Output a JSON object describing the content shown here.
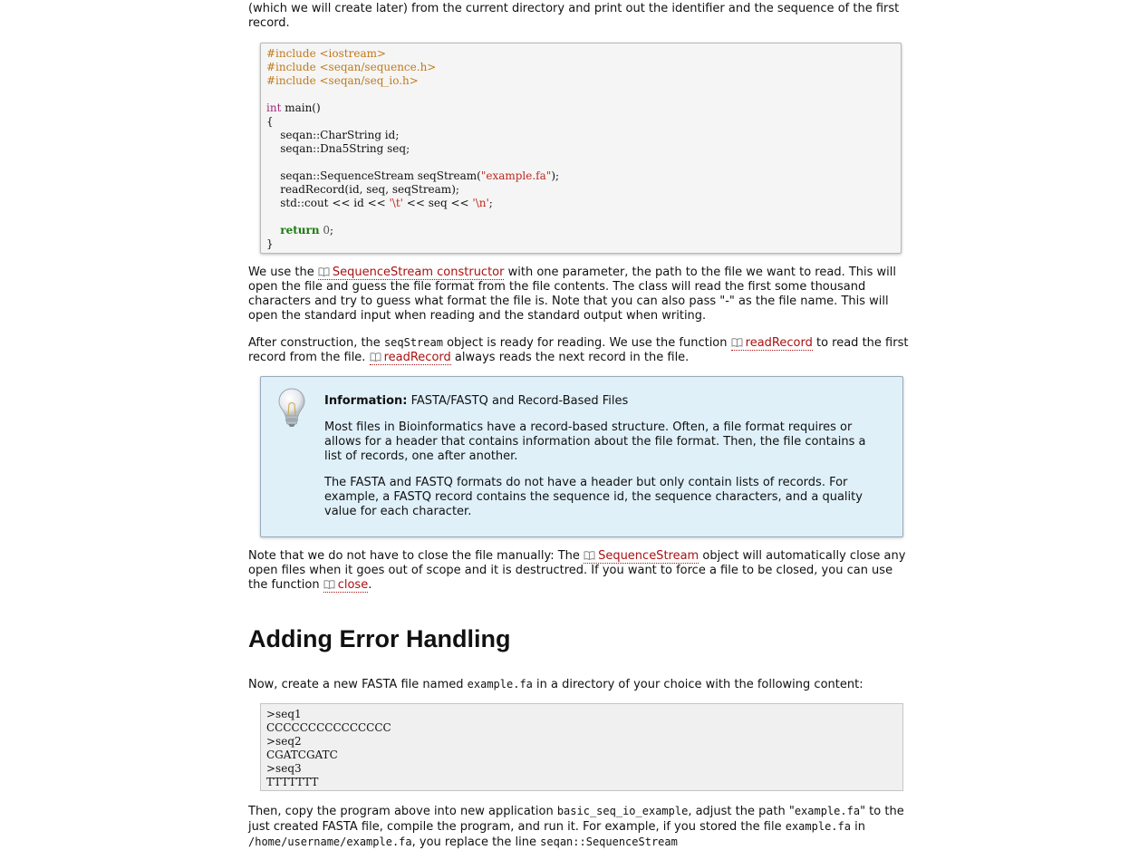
{
  "intro": {
    "text": "(which we will create later) from the current directory and print out the identifier and the sequence of the first record."
  },
  "code": {
    "lines": [
      [
        {
          "t": "#include <iostream>",
          "c": "pp"
        }
      ],
      [
        {
          "t": "#include <seqan/sequence.h>",
          "c": "pp"
        }
      ],
      [
        {
          "t": "#include <seqan/seq_io.h>",
          "c": "pp"
        }
      ],
      [],
      [
        {
          "t": "int",
          "c": "kw"
        },
        {
          "t": " main()"
        }
      ],
      [
        {
          "t": "{"
        }
      ],
      [
        {
          "t": "    seqan::CharString id;"
        }
      ],
      [
        {
          "t": "    seqan::Dna5String seq;"
        }
      ],
      [],
      [
        {
          "t": "    seqan::SequenceStream seqStream("
        },
        {
          "t": "\"example.fa\"",
          "c": "str"
        },
        {
          "t": ");"
        }
      ],
      [
        {
          "t": "    readRecord(id, seq, seqStream);"
        }
      ],
      [
        {
          "t": "    std::cout << id << "
        },
        {
          "t": "'\\t'",
          "c": "str"
        },
        {
          "t": " << seq << "
        },
        {
          "t": "'\\n'",
          "c": "str"
        },
        {
          "t": ";"
        }
      ],
      [],
      [
        {
          "t": "    "
        },
        {
          "t": "return",
          "c": "kw2"
        },
        {
          "t": " "
        },
        {
          "t": "0",
          "c": "num"
        },
        {
          "t": ";"
        }
      ],
      [
        {
          "t": "}"
        }
      ]
    ]
  },
  "para1": {
    "before": "We use the ",
    "link": "SequenceStream constructor",
    "after": " with one parameter, the path to the file we want to read. This will open the file and guess the file format from the file contents. The class will read the first some thousand characters and try to guess what format the file is. Note that you can also pass \"-\" as the file name. This will open the standard input when reading and the standard output when writing."
  },
  "para2": {
    "t1": "After construction, the ",
    "code1": "seqStream",
    "t2": " object is ready for reading. We use the function ",
    "link1": "readRecord",
    "t3": " to read the first record from the file. ",
    "link2": "readRecord",
    "t4": " always reads the next record in the file."
  },
  "info": {
    "label": "Information:",
    "title": "FASTA/FASTQ and Record-Based Files",
    "p1": "Most files in Bioinformatics have a record-based structure. Often, a file format requires or allows for a header that contains information about the file format. Then, the file contains a list of records, one after another.",
    "p2": "The FASTA and FASTQ formats do not have a header but only contain lists of records. For example, a FASTQ record contains the sequence id, the sequence characters, and a quality value for each character."
  },
  "para3": {
    "t1": "Note that we do not have to close the file manually: The ",
    "link1": "SequenceStream",
    "t2": " object will automatically close any open files when it goes out of scope and it is destructred. If you want to force a file to be closed, you can use the function ",
    "link2": "close",
    "t3": "."
  },
  "heading": "Adding Error Handling",
  "para4": {
    "t1": "Now, create a new FASTA file named ",
    "code1": "example.fa",
    "t2": " in a directory of your choice with the following content:"
  },
  "fasta": {
    "lines": [
      ">seq1",
      "CCCCCCCCCCCCCCC",
      ">seq2",
      "CGATCGATC",
      ">seq3",
      "TTTTTTT"
    ]
  },
  "para5": {
    "t1": "Then, copy the program above into new application ",
    "code1": "basic_seq_io_example",
    "t2": ", adjust the path \"",
    "code2": "example.fa",
    "t3": "\" to the just created FASTA file, compile the program, and run it. For example, if you stored the file ",
    "code3": "example.fa",
    "t4": " in ",
    "code4": "/home/username/example.fa",
    "t5": ", you replace the line ",
    "code5": "seqan::SequenceStream"
  }
}
